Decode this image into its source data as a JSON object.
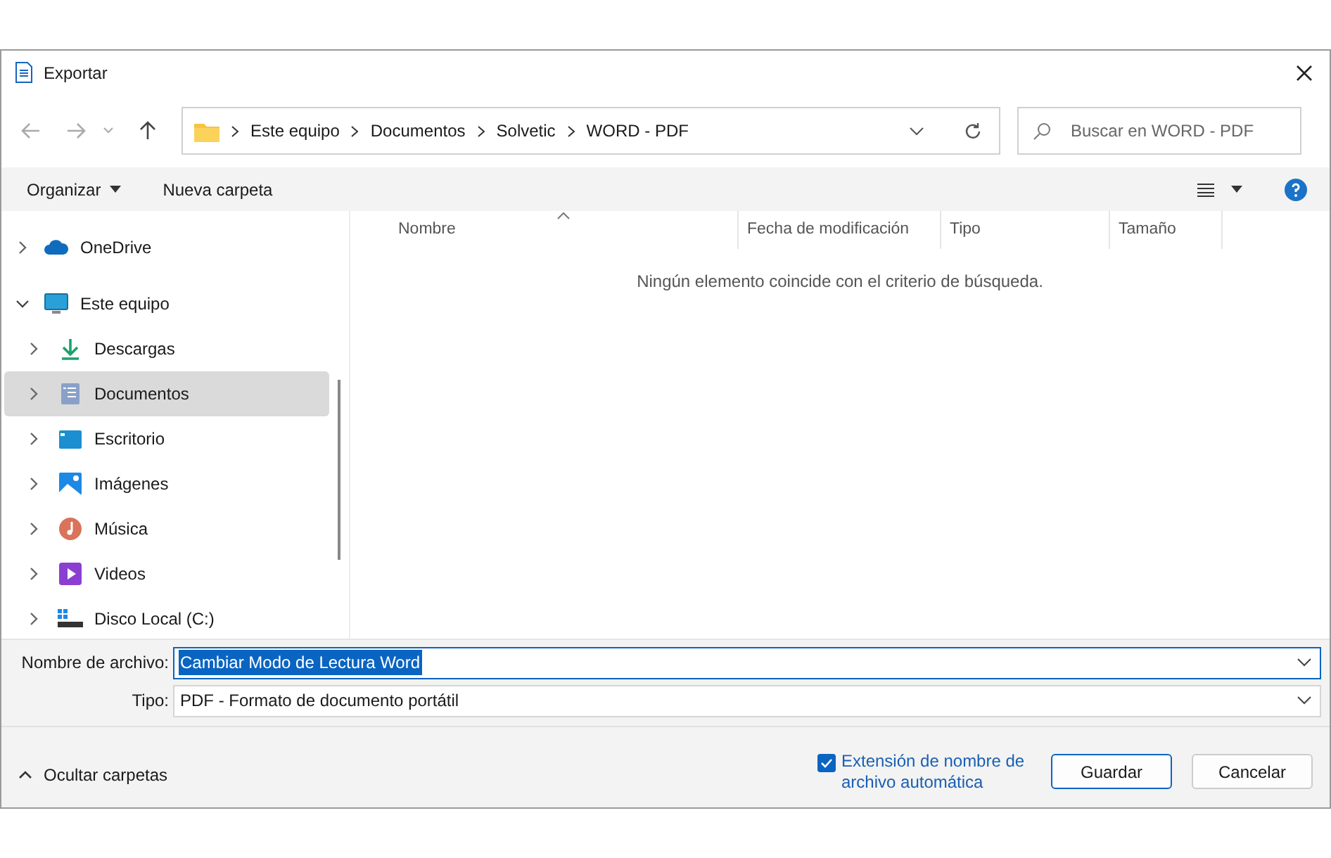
{
  "window": {
    "title": "Exportar"
  },
  "address_bar": {
    "crumbs": [
      "Este equipo",
      "Documentos",
      "Solvetic",
      "WORD - PDF"
    ]
  },
  "search": {
    "placeholder": "Buscar en WORD - PDF"
  },
  "toolbar": {
    "organize": "Organizar",
    "new_folder": "Nueva carpeta"
  },
  "sidebar": {
    "items": [
      {
        "label": "OneDrive",
        "expanded": false,
        "selected": false
      },
      {
        "label": "Este equipo",
        "expanded": true,
        "selected": false,
        "children": [
          {
            "label": "Descargas",
            "expanded": false,
            "selected": false
          },
          {
            "label": "Documentos",
            "expanded": false,
            "selected": true
          },
          {
            "label": "Escritorio",
            "expanded": false,
            "selected": false
          },
          {
            "label": "Imágenes",
            "expanded": false,
            "selected": false
          },
          {
            "label": "Música",
            "expanded": false,
            "selected": false
          },
          {
            "label": "Videos",
            "expanded": false,
            "selected": false
          },
          {
            "label": "Disco Local (C:)",
            "expanded": false,
            "selected": false
          }
        ]
      }
    ]
  },
  "table": {
    "columns": [
      "Nombre",
      "Fecha de modificación",
      "Tipo",
      "Tamaño"
    ],
    "empty_message": "Ningún elemento coincide con el criterio de búsqueda."
  },
  "filename": {
    "label": "Nombre de archivo:",
    "value": "Cambiar Modo de Lectura Word"
  },
  "type": {
    "label": "Tipo:",
    "value": "PDF - Formato de documento portátil"
  },
  "footer": {
    "hide_folders": "Ocultar carpetas",
    "auto_extension": {
      "label": "Extensión de nombre de archivo automática",
      "checked": true
    },
    "buttons": [
      "Guardar",
      "Cancelar"
    ]
  }
}
